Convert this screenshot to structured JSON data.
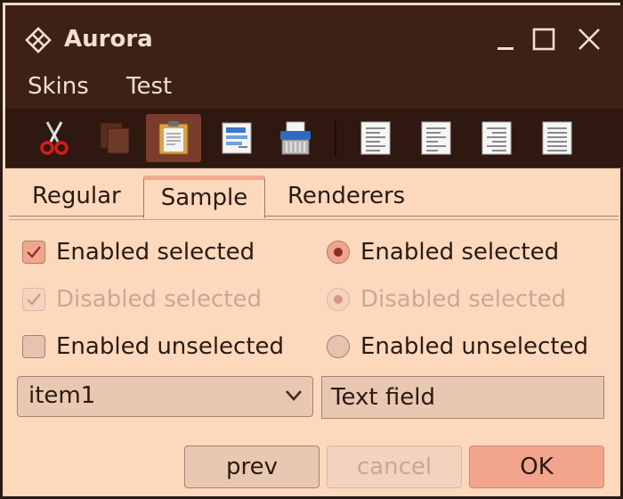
{
  "window": {
    "title": "Aurora"
  },
  "icons": {
    "app": "diamond-lattice-icon",
    "minimize": "minimize-icon",
    "maximize": "maximize-icon",
    "close": "close-icon"
  },
  "menubar": {
    "items": [
      "Skins",
      "Test"
    ]
  },
  "toolbar": {
    "buttons": [
      "cut-icon",
      "copy-icon",
      "paste-icon",
      "text-document-icon",
      "shredder-icon",
      "align-left-icon",
      "align-left-2-icon",
      "align-right-icon",
      "justify-icon"
    ],
    "active_index": 2
  },
  "tabs": {
    "items": [
      "Regular",
      "Sample",
      "Renderers"
    ],
    "selected": "Sample"
  },
  "checkboxes": [
    {
      "label": "Enabled selected",
      "checked": true,
      "enabled": true
    },
    {
      "label": "Disabled selected",
      "checked": true,
      "enabled": false
    },
    {
      "label": "Enabled unselected",
      "checked": false,
      "enabled": true
    }
  ],
  "radios": [
    {
      "label": "Enabled selected",
      "checked": true,
      "enabled": true
    },
    {
      "label": "Disabled selected",
      "checked": true,
      "enabled": false
    },
    {
      "label": "Enabled unselected",
      "checked": false,
      "enabled": true
    }
  ],
  "combo": {
    "value": "item1"
  },
  "textfield": {
    "value": "Text field"
  },
  "buttons": {
    "prev": "prev",
    "cancel": "cancel",
    "ok": "OK"
  },
  "colors": {
    "background": "#fcd8bd",
    "titlebar": "#3d2016",
    "accent": "#f2a58c"
  }
}
